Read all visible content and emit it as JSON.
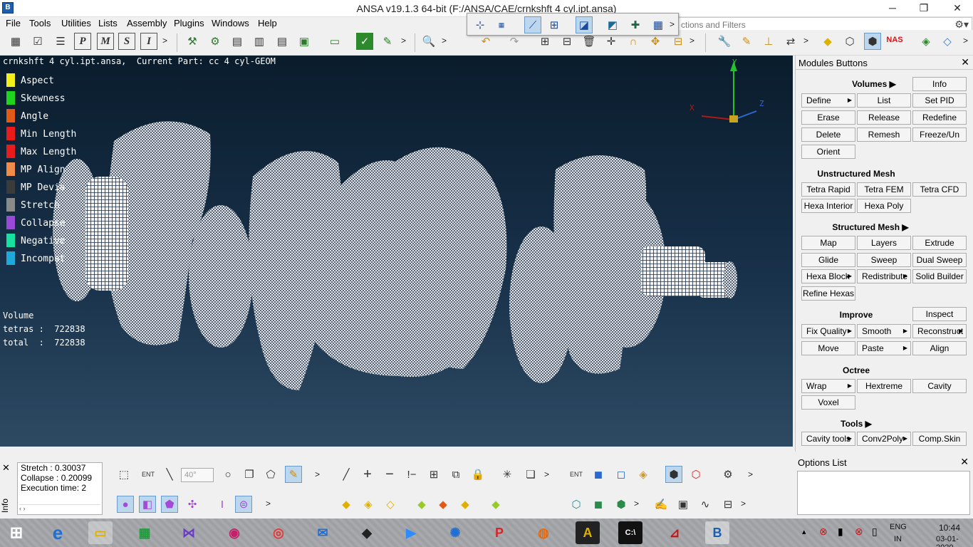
{
  "window": {
    "title": "ANSA v19.1.3 64-bit (F:/ANSA/CAE/crnkshft 4 cyl.ipt.ansa)",
    "app_icon_text": "B",
    "minimize": "─",
    "maximize": "❐",
    "close": "✕"
  },
  "menu": [
    "File",
    "Tools",
    "Utilities",
    "Lists",
    "Assembly",
    "Plugins",
    "Windows",
    "Help"
  ],
  "search": {
    "placeholder": "ctions and Filters"
  },
  "viewport": {
    "title": "crnkshft 4 cyl.ipt.ansa,  Current Part: cc 4 cyl-GEOM",
    "legend": [
      {
        "label": "Aspect",
        "color": "#f2f01a"
      },
      {
        "label": "Skewness",
        "color": "#1ed41e"
      },
      {
        "label": "Angle",
        "color": "#e25a17"
      },
      {
        "label": "Min Length",
        "color": "#e81c1c"
      },
      {
        "label": "Max Length",
        "color": "#e81c1c"
      },
      {
        "label": "MP Align",
        "color": "#f08c4a"
      },
      {
        "label": "MP Devia",
        "color": "#3b3b3b"
      },
      {
        "label": "Stretch",
        "color": "#8a8a8a"
      },
      {
        "label": "Collapse",
        "color": "#9a4ad6"
      },
      {
        "label": "Negative",
        "color": "#17e0a0"
      },
      {
        "label": "Incompat",
        "color": "#1ea9d8"
      }
    ],
    "stats": {
      "heading": "Volume",
      "tetras": "tetras :  722838",
      "total": "total  :  722838"
    },
    "axes": {
      "x": "X",
      "y": "Y",
      "z": "Z"
    }
  },
  "modules": {
    "title": "Modules Buttons",
    "close": "✕",
    "sections": {
      "volumes": "Volumes ▶",
      "unstructured": "Unstructured Mesh",
      "structured": "Structured Mesh ▶",
      "improve": "Improve",
      "octree": "Octree",
      "tools": "Tools ▶"
    },
    "buttons": {
      "info": "Info",
      "define": "Define",
      "list": "List",
      "set_pid": "Set PID",
      "erase": "Erase",
      "release": "Release",
      "redefine": "Redefine",
      "delete": "Delete",
      "remesh": "Remesh",
      "freeze": "Freeze/Un",
      "orient": "Orient",
      "tetra_rapid": "Tetra Rapid",
      "tetra_fem": "Tetra FEM",
      "tetra_cfd": "Tetra CFD",
      "hexa_interior": "Hexa Interior",
      "hexa_poly": "Hexa Poly",
      "map": "Map",
      "layers": "Layers",
      "extrude": "Extrude",
      "glide": "Glide",
      "sweep": "Sweep",
      "dual_sweep": "Dual Sweep",
      "hexa_block": "Hexa Block",
      "redistribute": "Redistribute",
      "solid_builder": "Solid Builder",
      "refine_hexas": "Refine Hexas",
      "inspect": "Inspect",
      "fix_quality": "Fix Quality",
      "smooth": "Smooth",
      "reconstruct": "Reconstruct",
      "move": "Move",
      "paste": "Paste",
      "align": "Align",
      "wrap": "Wrap",
      "hextreme": "Hextreme",
      "cavity": "Cavity",
      "voxel": "Voxel",
      "cavity_tools": "Cavity tools",
      "conv2poly": "Conv2Poly",
      "comp_skin": "Comp.Skin"
    }
  },
  "options": {
    "title": "Options List",
    "close": "✕"
  },
  "info": {
    "tab": "Info",
    "close": "✕",
    "lines": [
      "Stretch : 0.30037",
      "Collapse : 0.20099",
      "Execution time: 2"
    ]
  },
  "bottom_toolbar": {
    "angle_value": "40°",
    "ent_label": "ENT"
  },
  "taskbar": {
    "lang1": "ENG",
    "lang2": "IN",
    "time": "10:44",
    "date": "03-01-2020"
  }
}
